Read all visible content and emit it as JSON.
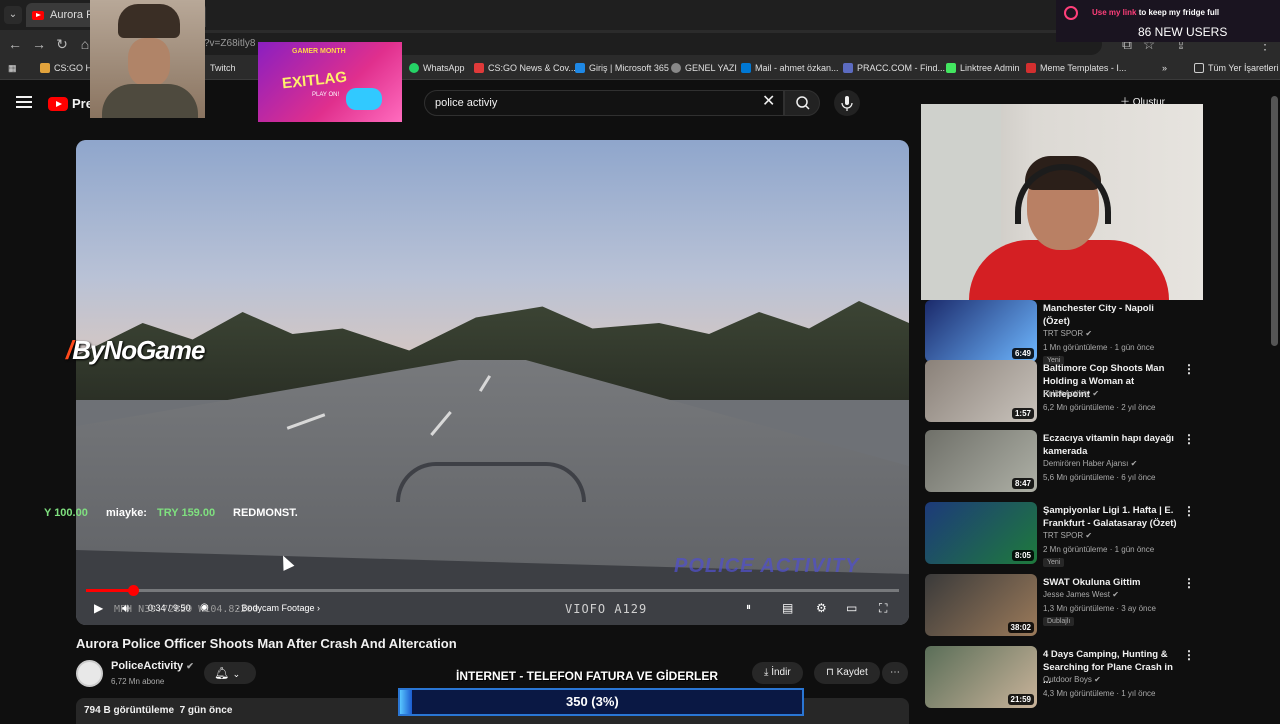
{
  "browser": {
    "tab_title": "Aurora Polic",
    "url": "?v=Z68itly8",
    "bookmarks": [
      {
        "label": "CS:GO Ho",
        "color": "#e2a33c"
      },
      {
        "label": "Twitch",
        "color": "#9146ff"
      },
      {
        "label": "WhatsApp",
        "color": "#25d366"
      },
      {
        "label": "CS:GO News & Cov...",
        "color": "#e03a3a"
      },
      {
        "label": "Giriş | Microsoft 365",
        "color": "#1e88e5"
      },
      {
        "label": "GENEL YAZI",
        "color": "#888888"
      },
      {
        "label": "Mail - ahmet özkan...",
        "color": "#0078d4"
      },
      {
        "label": "PRACC.COM - Find...",
        "color": "#5c6bc0"
      },
      {
        "label": "Linktree Admin",
        "color": "#43e660"
      },
      {
        "label": "Meme Templates - I...",
        "color": "#d32f2f"
      }
    ],
    "all_bookmarks": "Tüm Yer İşaretleri"
  },
  "youtube": {
    "logo_text": "Pre",
    "search_value": "police activiy",
    "create_label": "Oluştur"
  },
  "video": {
    "brand_overlay": {
      "part1": "By",
      "part2": "NoGame"
    },
    "donations": [
      {
        "text": "Y 100.00",
        "color": "#7fe07f"
      },
      {
        "text": "miayke:",
        "color": "#ffffff"
      },
      {
        "text": "TRY 159.00",
        "color": "#7fe07f"
      },
      {
        "text": "REDMONST.",
        "color": "#ffffff"
      }
    ],
    "watermark": "POLICE ACTIVITY",
    "camera_label": "VIOFO A129",
    "timestamp": "MPH N39.72829 W104.82200",
    "time_display": "0:34 / 9:50",
    "chapter": "Bodycam Footage",
    "progress_fraction": 0.058,
    "title": "Aurora Police Officer Shoots Man After Crash And Altercation"
  },
  "channel": {
    "name": "PoliceActivity",
    "subs": "6,72 Mn abone",
    "download_label": "İndir",
    "save_label": "Kaydet"
  },
  "meta": {
    "views": "794 B görüntüleme",
    "age": "7 gün önce"
  },
  "overlays": {
    "promo": {
      "line1": "GAMER MONTH",
      "line2": "EXITLAG",
      "line3": "PLAY ON!"
    },
    "stream_msg": {
      "highlight": "Use my link",
      "rest": " to keep my fridge full"
    },
    "new_users": "86 NEW USERS",
    "goal_label": "İNTERNET - TELEFON FATURA VE GİDERLER",
    "goal_value": "350 (3%)",
    "goal_fraction": 0.03
  },
  "recommendations": [
    {
      "title": "Manchester City - Napoli (Özet)",
      "channel": "TRT SPOR",
      "meta": "1 Mn görüntüleme · 1 gün önce",
      "badge": "Yeni",
      "duration": "6:49",
      "colors": [
        "#1b2a6b",
        "#6eb7ff"
      ]
    },
    {
      "title": "Baltimore Cop Shoots Man Holding a Woman at Knifepoint",
      "channel": "PoliceActivity",
      "meta": "6,2 Mn görüntüleme · 2 yıl önce",
      "badge": "",
      "duration": "1:57",
      "colors": [
        "#8a8179",
        "#c9c3bc"
      ]
    },
    {
      "title": "Eczacıya vitamin hapı dayağı kamerada",
      "channel": "Demirören Haber Ajansı",
      "meta": "5,6 Mn görüntüleme · 6 yıl önce",
      "badge": "",
      "duration": "8:47",
      "colors": [
        "#6f7069",
        "#aeb0a6"
      ]
    },
    {
      "title": "Şampiyonlar Ligi 1. Hafta | E. Frankfurt - Galatasaray (Özet)",
      "channel": "TRT SPOR",
      "meta": "2 Mn görüntüleme · 1 gün önce",
      "badge": "Yeni",
      "duration": "8:05",
      "colors": [
        "#1d3a7a",
        "#1e7a3c"
      ]
    },
    {
      "title": "SWAT Okuluna Gittim",
      "channel": "Jesse James West",
      "meta": "1,3 Mn görüntüleme · 3 ay önce",
      "badge": "Dublajlı",
      "duration": "38:02",
      "colors": [
        "#3a3a3a",
        "#9b7a5a"
      ]
    },
    {
      "title": "4 Days Camping, Hunting & Searching for Plane Crash in ...",
      "channel": "Outdoor Boys",
      "meta": "4,3 Mn görüntüleme · 1 yıl önce",
      "badge": "",
      "duration": "21:59",
      "colors": [
        "#5a6e58",
        "#c9b39a"
      ]
    }
  ]
}
